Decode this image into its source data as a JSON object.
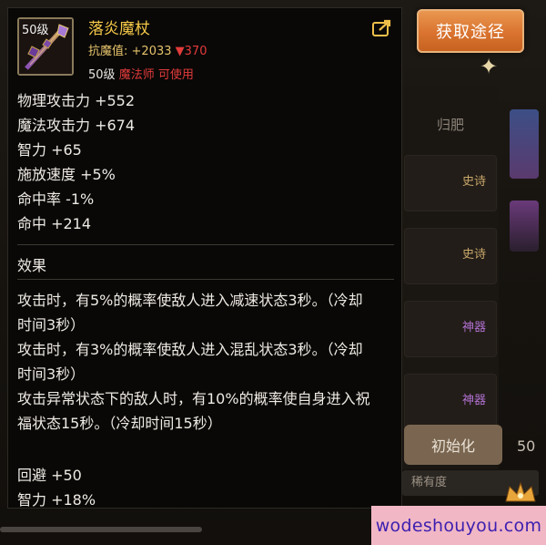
{
  "tooltip": {
    "level_badge": "50级",
    "name": "落炎魔杖",
    "resist_label": "抗魔值:",
    "resist_value": "+2033",
    "resist_down": "▼370",
    "req_level": "50级",
    "req_class": "魔法师 可使用",
    "stats": [
      "物理攻击力 +552",
      "魔法攻击力 +674",
      "智力 +65",
      "施放速度 +5%",
      "命中率 -1%",
      "命中 +214"
    ],
    "effect_title": "效果",
    "effects": [
      "攻击时，有5%的概率使敌人进入减速状态3秒。（冷却",
      "时间3秒）",
      "攻击时，有3%的概率使敌人进入混乱状态3秒。（冷却",
      "时间3秒）",
      "攻击异常状态下的敌人时，有10%的概率使自身进入祝",
      "福状态15秒。（冷却时间15秒）"
    ],
    "extra_stats": [
      "回避 +50",
      "智力 +18%"
    ]
  },
  "obtain_button": "获取途径",
  "background": {
    "tab_label": "归肥",
    "slot_labels": [
      "史诗",
      "史诗",
      "神器",
      "神器"
    ],
    "init_button": "初始化",
    "rarity_label": "稀有度",
    "side_number": "50"
  },
  "watermark": "wodeshouyou.com",
  "colors": {
    "item_name": "#f7c948",
    "resist": "#e6c36b",
    "class_req": "#e23b3b",
    "button_orange": "#d9732f",
    "epic_gold": "#c9a86a",
    "artifact_purple": "#b070d0"
  }
}
